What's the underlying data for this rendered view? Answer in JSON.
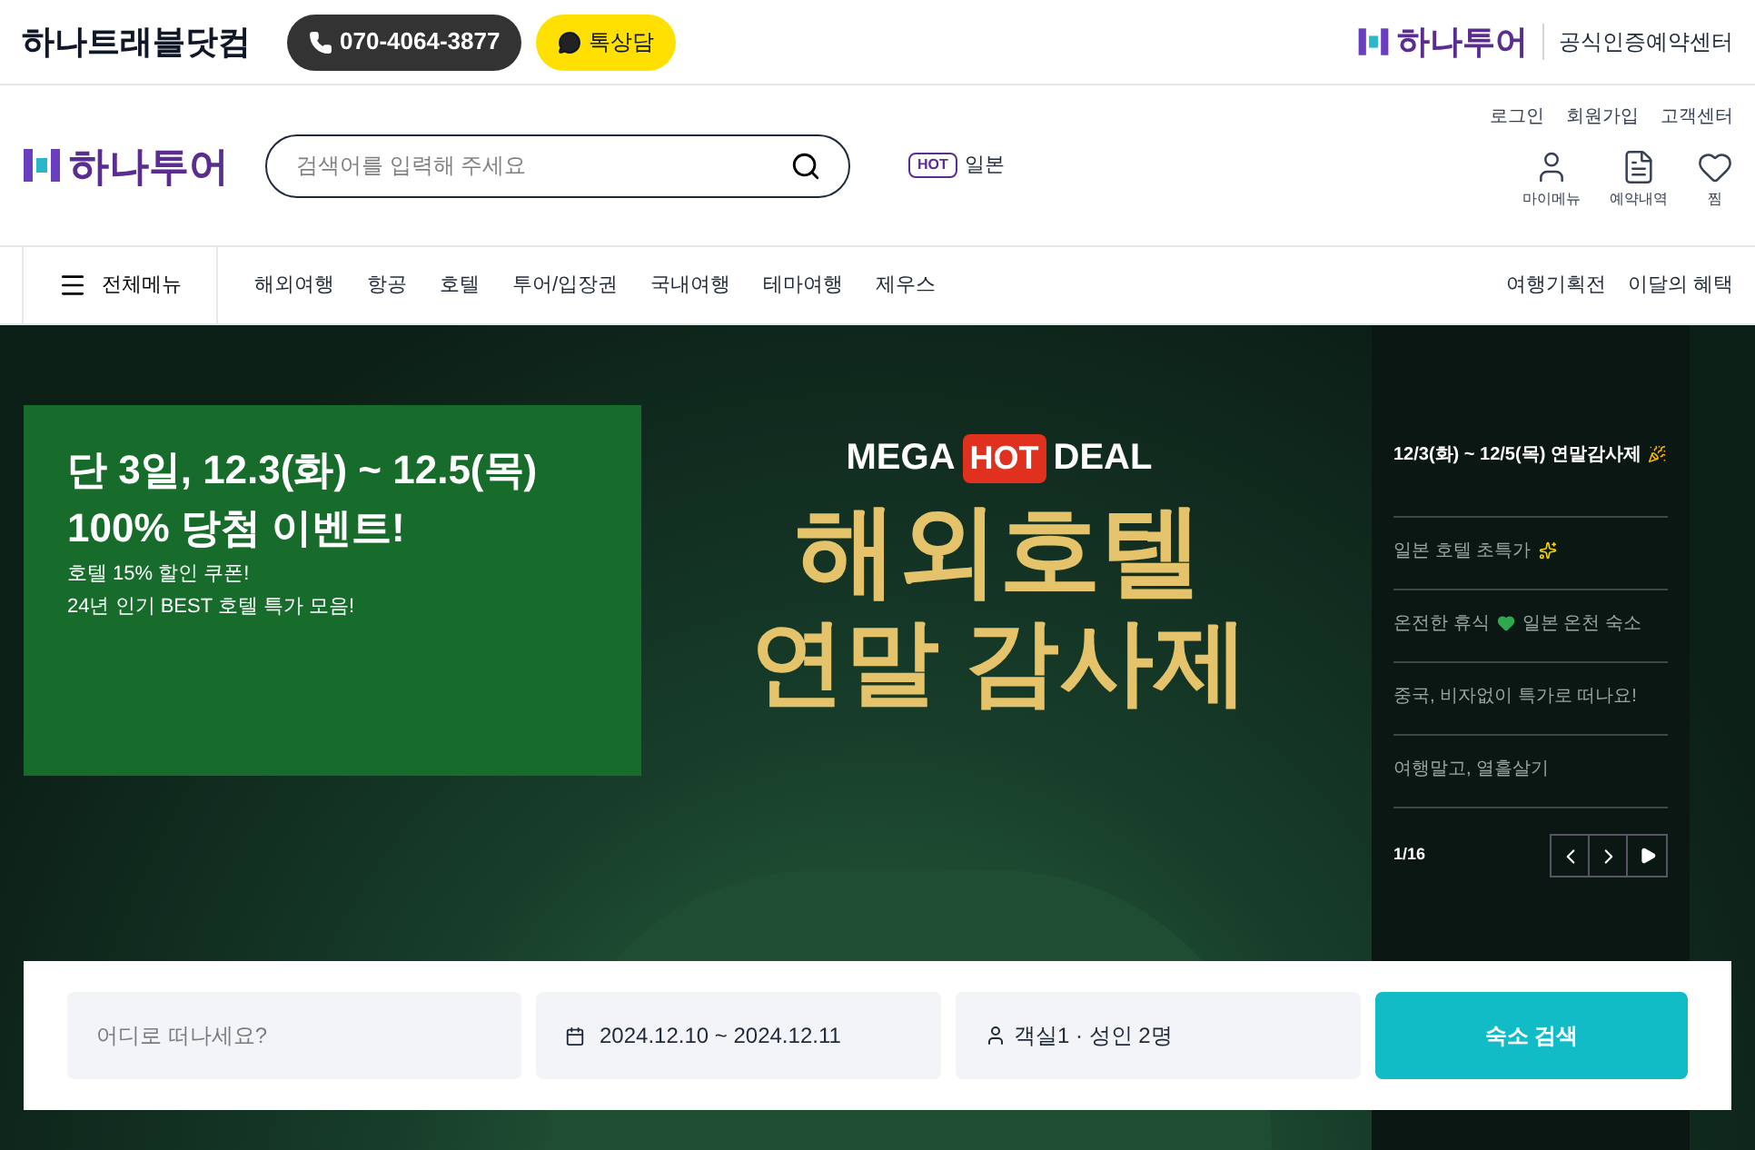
{
  "topbar": {
    "brand": "하나트래블닷컴",
    "phone": "070-4064-3877",
    "chat": "톡상담",
    "partner_logo": "하나투어",
    "partner_label": "공식인증예약센터"
  },
  "header": {
    "util_links": [
      "로그인",
      "회원가입",
      "고객센터"
    ],
    "logo": "하나투어",
    "search": {
      "placeholder": "검색어를 입력해 주세요"
    },
    "hot_badge": "HOT",
    "hot_keyword": "일본",
    "icons": [
      {
        "kind": "person",
        "label": "마이메뉴"
      },
      {
        "kind": "doc",
        "label": "예약내역"
      },
      {
        "kind": "heart",
        "label": "찜"
      }
    ]
  },
  "nav": {
    "all_menu": "전체메뉴",
    "items": [
      "해외여행",
      "항공",
      "호텔",
      "투어/입장권",
      "국내여행",
      "테마여행",
      "제우스"
    ],
    "right_items": [
      "여행기획전",
      "이달의 혜택"
    ]
  },
  "hero": {
    "promo": {
      "headline_1": "단 3일, 12.3(화) ~ 12.5(목)",
      "headline_2": "100% 당첨 이벤트!",
      "lines": [
        "호텔 15% 할인 쿠폰!",
        "24년 인기 BEST 호텔 특가 모음!"
      ]
    },
    "banner": {
      "mega": "MEGA",
      "hot": "HOT",
      "deal": "DEAL",
      "title_1": "해외호텔",
      "title_2": "연말 감사제"
    },
    "list": [
      {
        "kind": "party",
        "text": "12/3(화) ~ 12/5(목) 연말감사제",
        "selected": true
      },
      {
        "kind": "sparkle",
        "text": "일본 호텔 초특가",
        "selected": false
      },
      {
        "kind": "heart",
        "text": "온전한 휴식",
        "text_after": "일본 온천 숙소",
        "selected": false
      },
      {
        "kind": "plain",
        "text": "중국, 비자없이 특가로 떠나요!",
        "selected": false
      },
      {
        "kind": "plain",
        "text": "여행말고, 열흘살기",
        "selected": false
      }
    ],
    "pager": "1/16"
  },
  "booking": {
    "destination": {
      "placeholder": "어디로 떠나세요?"
    },
    "dates": "2024.12.10 ~ 2024.12.11",
    "guests": "객실1 · 성인 2명",
    "search_button": "숙소 검색"
  }
}
